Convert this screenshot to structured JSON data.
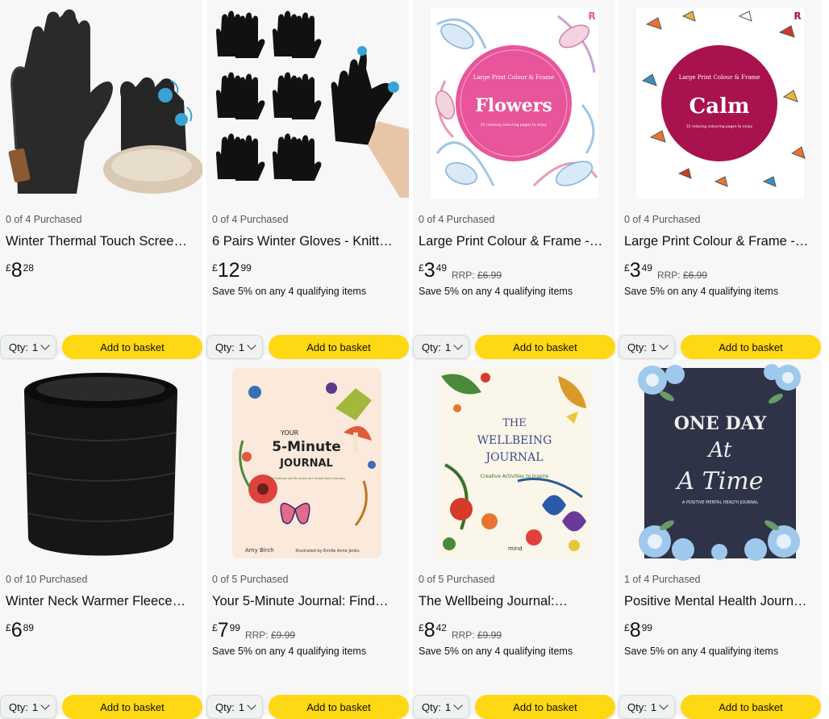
{
  "products": [
    {
      "purchased": "0 of 4 Purchased",
      "title": "Winter Thermal Touch Scree…",
      "currency": "£",
      "price_whole": "8",
      "price_frac": "28",
      "rrp_label": "",
      "rrp_value": "",
      "save_text": "",
      "qty_label": "Qty:",
      "qty_value": "1",
      "button": "Add to basket",
      "image_icon": "black-touchscreen-glove-image"
    },
    {
      "purchased": "0 of 4 Purchased",
      "title": "6 Pairs Winter Gloves - Knitt…",
      "currency": "£",
      "price_whole": "12",
      "price_frac": "99",
      "rrp_label": "",
      "rrp_value": "",
      "save_text": "Save 5% on any 4 qualifying items",
      "qty_label": "Qty:",
      "qty_value": "1",
      "button": "Add to basket",
      "image_icon": "six-pairs-gloves-image"
    },
    {
      "purchased": "0 of 4 Purchased",
      "title": "Large Print Colour & Frame -…",
      "currency": "£",
      "price_whole": "3",
      "price_frac": "49",
      "rrp_label": "RRP:",
      "rrp_value": "£6.99",
      "save_text": "Save 5% on any 4 qualifying items",
      "qty_label": "Qty:",
      "qty_value": "1",
      "button": "Add to basket",
      "image_icon": "flowers-colouring-book-cover",
      "cover": {
        "small": "Large Print\nColour & Frame",
        "big": "Flowers",
        "sub": "31 relaxing colouring pages to enjoy",
        "logo": "R"
      }
    },
    {
      "purchased": "0 of 4 Purchased",
      "title": "Large Print Colour & Frame -…",
      "currency": "£",
      "price_whole": "3",
      "price_frac": "49",
      "rrp_label": "RRP:",
      "rrp_value": "£6.99",
      "save_text": "Save 5% on any 4 qualifying items",
      "qty_label": "Qty:",
      "qty_value": "1",
      "button": "Add to basket",
      "image_icon": "calm-colouring-book-cover",
      "cover": {
        "small": "Large Print\nColour & Frame",
        "big": "Calm",
        "sub": "31 relaxing colouring pages to enjoy",
        "logo": "R"
      }
    },
    {
      "purchased": "0 of 10 Purchased",
      "title": "Winter Neck Warmer Fleece…",
      "currency": "£",
      "price_whole": "6",
      "price_frac": "89",
      "rrp_label": "",
      "rrp_value": "",
      "save_text": "",
      "qty_label": "Qty:",
      "qty_value": "1",
      "button": "Add to basket",
      "image_icon": "neck-warmer-image"
    },
    {
      "purchased": "0 of 5 Purchased",
      "title": "Your 5-Minute Journal: Find…",
      "currency": "£",
      "price_whole": "7",
      "price_frac": "99",
      "rrp_label": "RRP:",
      "rrp_value": "£9.99",
      "save_text": "Save 5% on any 4 qualifying items",
      "qty_label": "Qty:",
      "qty_value": "1",
      "button": "Add to basket",
      "image_icon": "five-minute-journal-cover",
      "cover": {
        "your": "YOUR",
        "big": "5-Minute",
        "big2": "JOURNAL",
        "sub": "Find Gratitude and De-stress with Simple Daily Exercises",
        "author": "Amy Birch",
        "illus": "Illustrated by Emilie Anne Jenks"
      }
    },
    {
      "purchased": "0 of 5 Purchased",
      "title": "The Wellbeing Journal:…",
      "currency": "£",
      "price_whole": "8",
      "price_frac": "42",
      "rrp_label": "RRP:",
      "rrp_value": "£9.99",
      "save_text": "Save 5% on any 4 qualifying items",
      "qty_label": "Qty:",
      "qty_value": "1",
      "button": "Add to basket",
      "image_icon": "wellbeing-journal-cover",
      "cover": {
        "l1": "THE",
        "l2": "WELLBEING",
        "l3": "JOURNAL",
        "sub": "Creative Activities to Inspire",
        "brand": "mind"
      }
    },
    {
      "purchased": "1 of 4 Purchased",
      "title": "Positive Mental Health Journ…",
      "currency": "£",
      "price_whole": "8",
      "price_frac": "99",
      "rrp_label": "",
      "rrp_value": "",
      "save_text": "Save 5% on any 4 qualifying items",
      "qty_label": "Qty:",
      "qty_value": "1",
      "button": "Add to basket",
      "image_icon": "one-day-at-a-time-journal-cover",
      "cover": {
        "l1": "ONE DAY",
        "l2": "At",
        "l3": "A Time",
        "sub": "A POSITIVE MENTAL HEALTH JOURNAL"
      }
    }
  ]
}
